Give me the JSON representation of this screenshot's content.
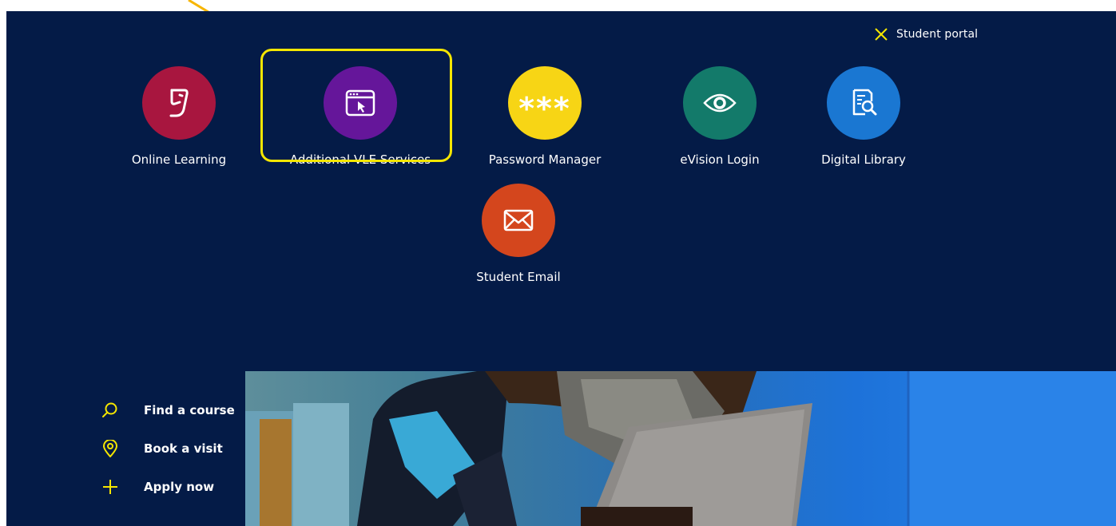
{
  "portal": {
    "toggle_label": "Student portal"
  },
  "tiles": [
    {
      "label": "Online Learning",
      "color": "#a8163f",
      "icon": "online-learning-icon"
    },
    {
      "label": "Additional VLE Services",
      "color": "#65169a",
      "icon": "browser-cursor-icon"
    },
    {
      "label": "Password Manager",
      "color": "#f7d515",
      "icon": "password-asterisks-icon",
      "icon_text": "***"
    },
    {
      "label": "eVision Login",
      "color": "#137a6a",
      "icon": "eye-icon"
    },
    {
      "label": "Digital Library",
      "color": "#1a77d2",
      "icon": "document-search-icon"
    },
    {
      "label": "Student Email",
      "color": "#d4461d",
      "icon": "envelope-icon"
    }
  ],
  "quick_links": [
    {
      "label": "Find a course",
      "icon": "search-icon"
    },
    {
      "label": "Book a visit",
      "icon": "location-pin-icon"
    },
    {
      "label": "Apply now",
      "icon": "plus-icon"
    }
  ],
  "colors": {
    "background": "#041b47",
    "accent_yellow": "#f5e600",
    "arrow": "#f7b500"
  }
}
